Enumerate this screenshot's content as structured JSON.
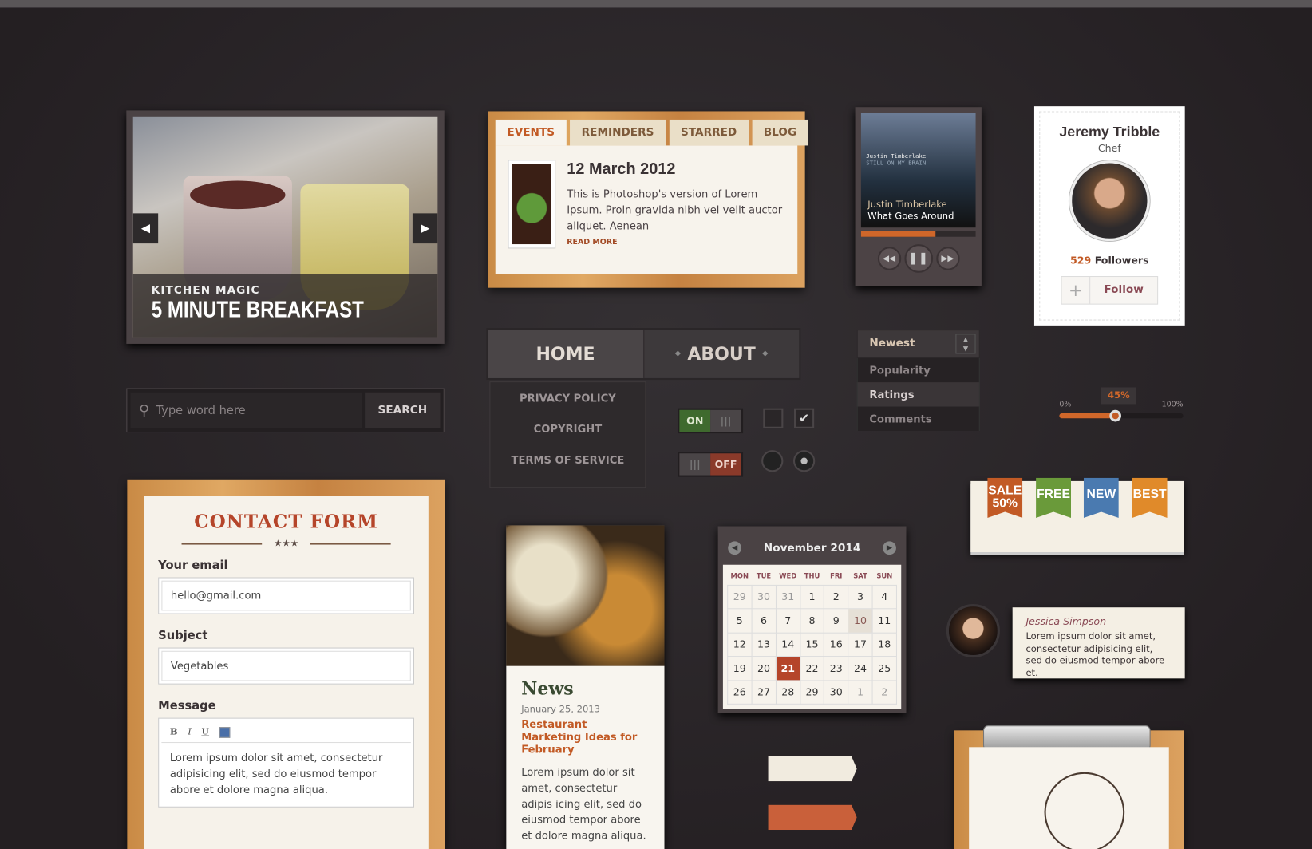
{
  "slider": {
    "kicker": "KITCHEN  MAGIC",
    "title": "5 MINUTE BREAKFAST",
    "prev_icon": "chevron-left",
    "next_icon": "chevron-right"
  },
  "search": {
    "placeholder": "Type word here",
    "button": "SEARCH"
  },
  "tabs": {
    "items": [
      "EVENTS",
      "REMINDERS",
      "STARRED",
      "BLOG"
    ],
    "active": "EVENTS",
    "date": "12 March 2012",
    "text": "This is Photoshop's version  of Lorem Ipsum. Proin gravida nibh vel velit auctor aliquet. Aenean",
    "read_more": "READ MORE"
  },
  "nav": {
    "items": [
      "HOME",
      "ABOUT"
    ],
    "sub": [
      "PRIVACY POLICY",
      "COPYRIGHT",
      "TERMS OF SERVICE"
    ]
  },
  "toggles": {
    "on": "ON",
    "off": "OFF",
    "checkbox_checked": true,
    "radio_selected": 2
  },
  "player": {
    "album_artist": "Justin Timberlake",
    "album_title": "STILL ON MY BRAIN",
    "artist": "Justin Timberlake",
    "track": "What Goes Around",
    "progress": 0.65
  },
  "profile": {
    "name": "Jeremy Tribble",
    "role": "Chef",
    "followers": "529",
    "followers_label": "Followers",
    "plus": "+",
    "follow": "Follow"
  },
  "dropdown": {
    "selected": "Newest",
    "options": [
      "Popularity",
      "Ratings",
      "Comments"
    ],
    "highlighted": "Ratings"
  },
  "range": {
    "min": "0%",
    "max": "100%",
    "value_label": "45%",
    "value": 45,
    "accent": "#d0672a"
  },
  "ribbons": [
    {
      "label": "SALE 50%",
      "color": "#c25a25"
    },
    {
      "label": "FREE",
      "color": "#6a9a3a"
    },
    {
      "label": "NEW",
      "color": "#4a7ab0"
    },
    {
      "label": "BEST",
      "color": "#e08a2a"
    }
  ],
  "contact": {
    "title": "CONTACT FORM",
    "stars": "★★★",
    "email_label": "Your email",
    "email": "hello@gmail.com",
    "subject_label": "Subject",
    "subject": "Vegetables",
    "message_label": "Message",
    "toolbar": [
      "B",
      "I",
      "U"
    ],
    "message": "Lorem ipsum dolor sit amet, consectetur adipisicing elit, sed do eiusmod tempor abore et dolore magna aliqua."
  },
  "news": {
    "title": "News",
    "date": "January 25, 2013",
    "headline": "Restaurant Marketing Ideas for February",
    "text": "Lorem ipsum dolor sit amet, consectetur adipis icing elit, sed do eiusmod tempor abore et dolore magna aliqua."
  },
  "calendar": {
    "month": "November 2014",
    "days": [
      "MON",
      "TUE",
      "WED",
      "THU",
      "FRI",
      "SAT",
      "SUN"
    ],
    "weeks": [
      [
        "29",
        "30",
        "31",
        "1",
        "2",
        "3",
        "4"
      ],
      [
        "5",
        "6",
        "7",
        "8",
        "9",
        "10",
        "11"
      ],
      [
        "12",
        "13",
        "14",
        "15",
        "16",
        "17",
        "18"
      ],
      [
        "19",
        "20",
        "21",
        "22",
        "23",
        "24",
        "25"
      ],
      [
        "26",
        "27",
        "28",
        "29",
        "30",
        "1",
        "2"
      ]
    ],
    "today": "21",
    "highlighted": "10"
  },
  "comment": {
    "name": "Jessica Simpson",
    "text": "Lorem ipsum dolor sit amet, consectetur adipisicing elit, sed do eiusmod tempor abore et."
  },
  "banners": [
    {
      "color": "#f1ebdf"
    },
    {
      "color": "#c9603a"
    }
  ]
}
